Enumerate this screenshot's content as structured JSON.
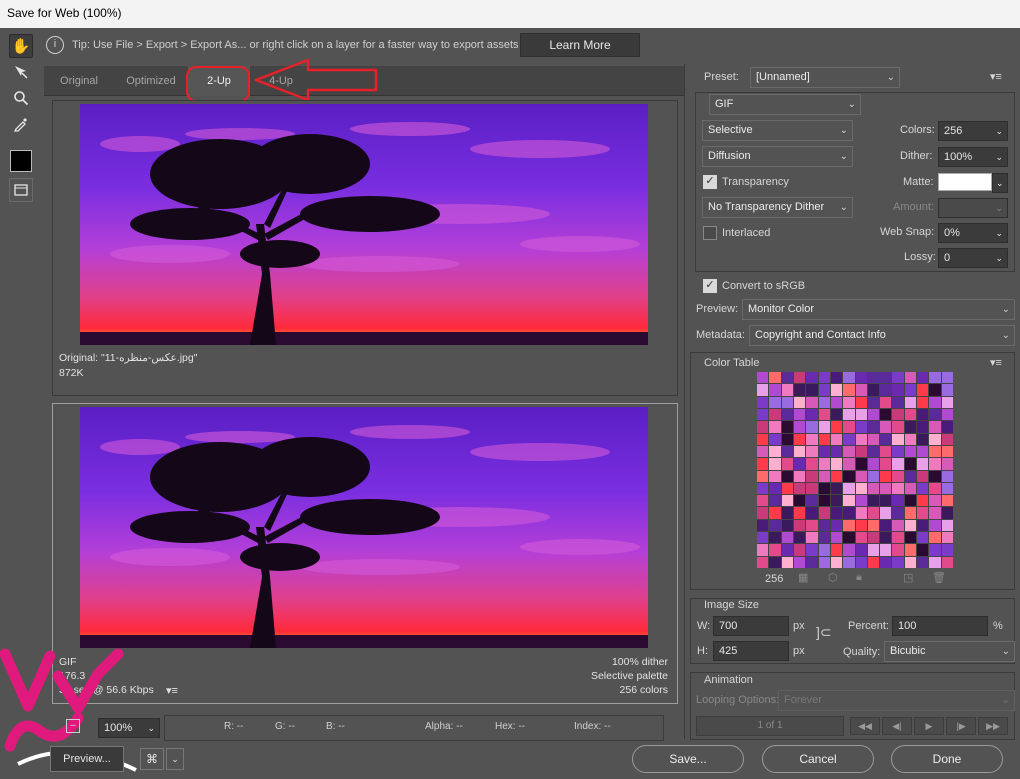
{
  "window": {
    "title": "Save for Web (100%)"
  },
  "tip": {
    "text": "Tip: Use File > Export > Export As...  or right click on a layer for a faster way to export assets",
    "learn_more": "Learn More"
  },
  "tabs": [
    {
      "label": "Original",
      "active": false
    },
    {
      "label": "Optimized",
      "active": false
    },
    {
      "label": "2-Up",
      "active": true
    },
    {
      "label": "4-Up",
      "active": false
    }
  ],
  "original_panel": {
    "name_line": "Original: \"11-عکس-منظره.jpg\"",
    "size": "872K"
  },
  "optimized_panel": {
    "format": "GIF",
    "size": "176.3",
    "time": "33 sec @ 56.6 Kbps",
    "dither": "100% dither",
    "palette": "Selective palette",
    "colors": "256 colors"
  },
  "status": {
    "zoom": "100%",
    "r": "R: --",
    "g": "G: --",
    "b": "B: --",
    "alpha": "Alpha: --",
    "hex": "Hex: --",
    "index": "Index: --"
  },
  "bottom": {
    "preview": "Preview...",
    "save": "Save...",
    "cancel": "Cancel",
    "done": "Done"
  },
  "settings": {
    "preset_label": "Preset:",
    "preset_value": "[Unnamed]",
    "format": "GIF",
    "reduction": "Selective",
    "dither_algo": "Diffusion",
    "colors_label": "Colors:",
    "colors_value": "256",
    "dither_label": "Dither:",
    "dither_value": "100%",
    "transparency_label": "Transparency",
    "transparency_checked": true,
    "matte_label": "Matte:",
    "trans_dither": "No Transparency Dither",
    "amount_label": "Amount:",
    "interlaced_label": "Interlaced",
    "interlaced_checked": false,
    "websnap_label": "Web Snap:",
    "websnap_value": "0%",
    "lossy_label": "Lossy:",
    "lossy_value": "0",
    "convert_label": "Convert to sRGB",
    "convert_checked": true,
    "preview_label": "Preview:",
    "preview_value": "Monitor Color",
    "metadata_label": "Metadata:",
    "metadata_value": "Copyright and Contact Info"
  },
  "color_table": {
    "title": "Color Table",
    "count": "256"
  },
  "image_size": {
    "title": "Image Size",
    "w_label": "W:",
    "w_value": "700",
    "h_label": "H:",
    "h_value": "425",
    "unit": "px",
    "percent_label": "Percent:",
    "percent_value": "100",
    "percent_unit": "%",
    "quality_label": "Quality:",
    "quality_value": "Bicubic"
  },
  "animation": {
    "title": "Animation",
    "looping_label": "Looping Options:",
    "looping_value": "Forever",
    "frame": "1 of 1"
  },
  "colors": {
    "accent_red": "#e8202a",
    "watermark_magenta": "#e0197d"
  }
}
